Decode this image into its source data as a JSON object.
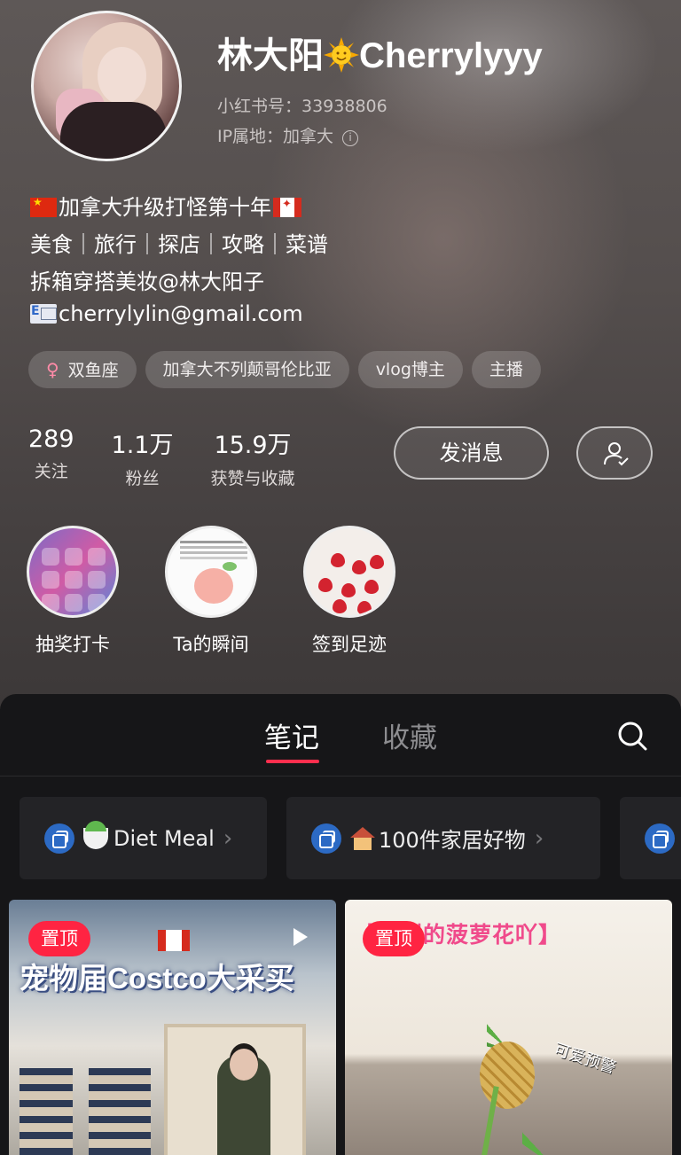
{
  "profile": {
    "name_prefix": "林大阳",
    "name_suffix": "Cherrylyyy",
    "red_id": "小红书号：33938806",
    "ip_location": "IP属地：加拿大",
    "bio_line1": "加拿大升级打怪第十年",
    "bio_line2": "美食｜旅行｜探店｜攻略｜菜谱",
    "bio_line3": "拆箱穿搭美妆@林大阳子",
    "bio_email": "cherrylylin@gmail.com",
    "tags": [
      "双鱼座",
      "加拿大不列颠哥伦比亚",
      "vlog博主",
      "主播"
    ],
    "stats": [
      {
        "num": "289",
        "label": "关注"
      },
      {
        "num": "1.1万",
        "label": "粉丝"
      },
      {
        "num": "15.9万",
        "label": "获赞与收藏"
      }
    ],
    "message_button": "发消息",
    "highlights": [
      {
        "label": "抽奖打卡"
      },
      {
        "label": "Ta的瞬间"
      },
      {
        "label": "签到足迹"
      }
    ]
  },
  "tabs": {
    "notes": "笔记",
    "collections": "收藏"
  },
  "collections": [
    {
      "label": "Diet Meal"
    },
    {
      "label": "100件家居好物"
    }
  ],
  "cards": [
    {
      "pin": "置顶",
      "title": "宠物届Costco大采买"
    },
    {
      "pin": "置顶",
      "title": "【买到的菠萝花吖】",
      "sticker": "可爱预警"
    }
  ],
  "icons": {
    "gender": "female-icon",
    "info": "info-icon",
    "follow": "user-check-icon",
    "search": "search-icon",
    "collection": "stack-icon",
    "chevron": "chevron-right-icon",
    "play": "play-icon"
  },
  "colors": {
    "accent": "#ff2442",
    "tab_underline": "#ff2e4d",
    "panel_bg": "#161618",
    "collection_icon": "#2c6ac4"
  }
}
